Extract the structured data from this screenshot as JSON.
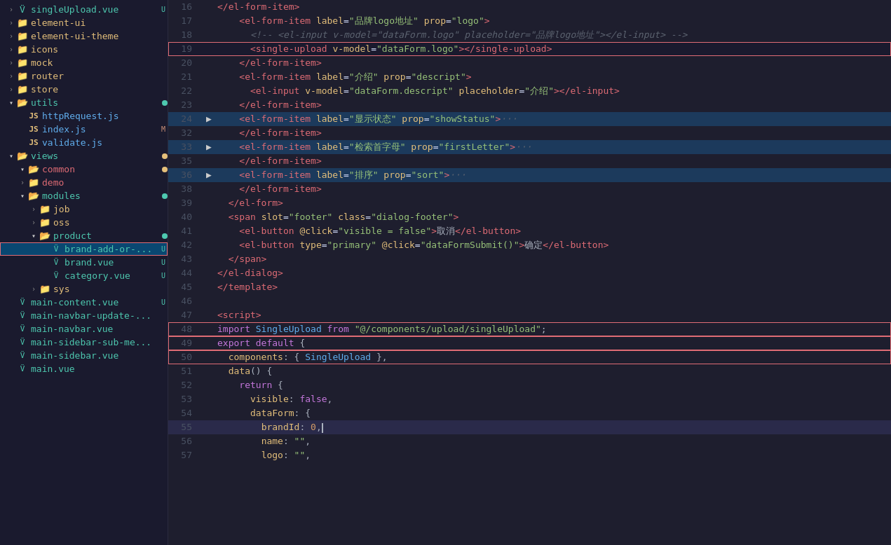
{
  "sidebar": {
    "items": [
      {
        "id": "singleUpload",
        "label": "singleUpload.vue",
        "indent": 1,
        "type": "vue",
        "badge": "U",
        "color": "green",
        "expanded": false
      },
      {
        "id": "element-ui",
        "label": "element-ui",
        "indent": 1,
        "type": "folder",
        "color": "yellow",
        "collapsed": true
      },
      {
        "id": "element-ui-theme",
        "label": "element-ui-theme",
        "indent": 1,
        "type": "folder",
        "color": "yellow",
        "collapsed": true
      },
      {
        "id": "icons",
        "label": "icons",
        "indent": 1,
        "type": "folder",
        "color": "yellow",
        "collapsed": true
      },
      {
        "id": "mock",
        "label": "mock",
        "indent": 1,
        "type": "folder",
        "color": "yellow",
        "collapsed": true
      },
      {
        "id": "router",
        "label": "router",
        "indent": 1,
        "type": "folder",
        "color": "yellow",
        "collapsed": true
      },
      {
        "id": "store",
        "label": "store",
        "indent": 1,
        "type": "folder",
        "color": "yellow",
        "collapsed": true
      },
      {
        "id": "utils",
        "label": "utils",
        "indent": 1,
        "type": "folder",
        "color": "green",
        "expanded": true,
        "dot": "green"
      },
      {
        "id": "httpRequest",
        "label": "httpRequest.js",
        "indent": 2,
        "type": "js",
        "color": "blue"
      },
      {
        "id": "index",
        "label": "index.js",
        "indent": 2,
        "type": "js",
        "badge": "M",
        "color": "blue"
      },
      {
        "id": "validate",
        "label": "validate.js",
        "indent": 2,
        "type": "js",
        "color": "blue"
      },
      {
        "id": "views",
        "label": "views",
        "indent": 1,
        "type": "folder",
        "color": "green",
        "expanded": true,
        "dot": "yellow"
      },
      {
        "id": "common",
        "label": "common",
        "indent": 2,
        "type": "folder",
        "color": "orange",
        "dot": "yellow",
        "expanded": true
      },
      {
        "id": "demo",
        "label": "demo",
        "indent": 2,
        "type": "folder",
        "color": "orange",
        "collapsed": true
      },
      {
        "id": "modules",
        "label": "modules",
        "indent": 2,
        "type": "folder",
        "color": "green",
        "expanded": true,
        "dot": "green"
      },
      {
        "id": "job",
        "label": "job",
        "indent": 3,
        "type": "folder",
        "color": "yellow",
        "collapsed": true
      },
      {
        "id": "oss",
        "label": "oss",
        "indent": 3,
        "type": "folder",
        "color": "yellow",
        "collapsed": true
      },
      {
        "id": "product",
        "label": "product",
        "indent": 3,
        "type": "folder",
        "color": "green",
        "expanded": true,
        "dot": "green"
      },
      {
        "id": "brand-add",
        "label": "brand-add-or-...",
        "indent": 4,
        "type": "vue",
        "badge": "U",
        "color": "green",
        "selected": true
      },
      {
        "id": "brand",
        "label": "brand.vue",
        "indent": 4,
        "type": "vue",
        "badge": "U",
        "color": "green"
      },
      {
        "id": "category",
        "label": "category.vue",
        "indent": 4,
        "type": "vue",
        "badge": "U",
        "color": "green"
      },
      {
        "id": "sys",
        "label": "sys",
        "indent": 3,
        "type": "folder",
        "color": "yellow",
        "collapsed": true
      },
      {
        "id": "main-content",
        "label": "main-content.vue",
        "indent": 1,
        "type": "vue",
        "color": "green",
        "badge": "U"
      },
      {
        "id": "main-navbar-update",
        "label": "main-navbar-update-...",
        "indent": 1,
        "type": "vue",
        "color": "green"
      },
      {
        "id": "main-navbar",
        "label": "main-navbar.vue",
        "indent": 1,
        "type": "vue",
        "color": "green"
      },
      {
        "id": "main-sidebar-sub-me",
        "label": "main-sidebar-sub-me...",
        "indent": 1,
        "type": "vue",
        "color": "green"
      },
      {
        "id": "main-sidebar",
        "label": "main-sidebar.vue",
        "indent": 1,
        "type": "vue",
        "color": "green"
      },
      {
        "id": "main",
        "label": "main.vue",
        "indent": 1,
        "type": "vue",
        "color": "green"
      }
    ]
  },
  "editor": {
    "lines": [
      {
        "num": 16,
        "content": "    </el-form-item>",
        "type": "normal"
      },
      {
        "num": 17,
        "content": "    <el-form-item label=\"品牌logo地址\" prop=\"logo\">",
        "type": "normal"
      },
      {
        "num": 18,
        "content": "      <!-- <el-input v-model=\"dataForm.logo\" placeholder=\"品牌logo地址\"></el-input> -->",
        "type": "comment"
      },
      {
        "num": 19,
        "content": "      <single-upload v-model=\"dataForm.logo\"></single-upload>",
        "type": "outlined"
      },
      {
        "num": 20,
        "content": "    </el-form-item>",
        "type": "normal"
      },
      {
        "num": 21,
        "content": "    <el-form-item label=\"介绍\" prop=\"descript\">",
        "type": "normal"
      },
      {
        "num": 22,
        "content": "      <el-input v-model=\"dataForm.descript\" placeholder=\"介绍\"></el-input>",
        "type": "normal"
      },
      {
        "num": 23,
        "content": "    </el-form-item>",
        "type": "normal"
      },
      {
        "num": 24,
        "content": "    <el-form-item label=\"显示状态\" prop=\"showStatus\">···",
        "type": "active",
        "arrow": "▶"
      },
      {
        "num": 32,
        "content": "    </el-form-item>",
        "type": "normal"
      },
      {
        "num": 33,
        "content": "    <el-form-item label=\"检索首字母\" prop=\"firstLetter\">···",
        "type": "active",
        "arrow": "▶"
      },
      {
        "num": 35,
        "content": "    </el-form-item>",
        "type": "normal"
      },
      {
        "num": 36,
        "content": "    <el-form-item label=\"排序\" prop=\"sort\">···",
        "type": "active",
        "arrow": "▶"
      },
      {
        "num": 38,
        "content": "    </el-form-item>",
        "type": "normal"
      },
      {
        "num": 39,
        "content": "  </el-form>",
        "type": "normal"
      },
      {
        "num": 40,
        "content": "  <span slot=\"footer\" class=\"dialog-footer\">",
        "type": "normal"
      },
      {
        "num": 41,
        "content": "    <el-button @click=\"visible = false\">取消</el-button>",
        "type": "normal"
      },
      {
        "num": 42,
        "content": "    <el-button type=\"primary\" @click=\"dataFormSubmit()\">确定</el-button>",
        "type": "normal"
      },
      {
        "num": 43,
        "content": "  </span>",
        "type": "normal"
      },
      {
        "num": 44,
        "content": "</el-dialog>",
        "type": "normal"
      },
      {
        "num": 45,
        "content": "</template>",
        "type": "normal"
      },
      {
        "num": 46,
        "content": "",
        "type": "normal"
      },
      {
        "num": 47,
        "content": "<script>",
        "type": "normal"
      },
      {
        "num": 48,
        "content": "import SingleUpload from \"@/components/upload/singleUpload\";",
        "type": "outlined2"
      },
      {
        "num": 49,
        "content": "export default {",
        "type": "outlined3"
      },
      {
        "num": 50,
        "content": "  components: { SingleUpload },",
        "type": "outlined4"
      },
      {
        "num": 51,
        "content": "  data() {",
        "type": "normal"
      },
      {
        "num": 52,
        "content": "    return {",
        "type": "normal"
      },
      {
        "num": 53,
        "content": "      visible: false,",
        "type": "normal"
      },
      {
        "num": 54,
        "content": "      dataForm: {",
        "type": "normal"
      },
      {
        "num": 55,
        "content": "        brandId: 0,|",
        "type": "cursor"
      },
      {
        "num": 56,
        "content": "        name: \"\",",
        "type": "normal"
      },
      {
        "num": 57,
        "content": "        logo: \"\",",
        "type": "normal"
      }
    ]
  }
}
